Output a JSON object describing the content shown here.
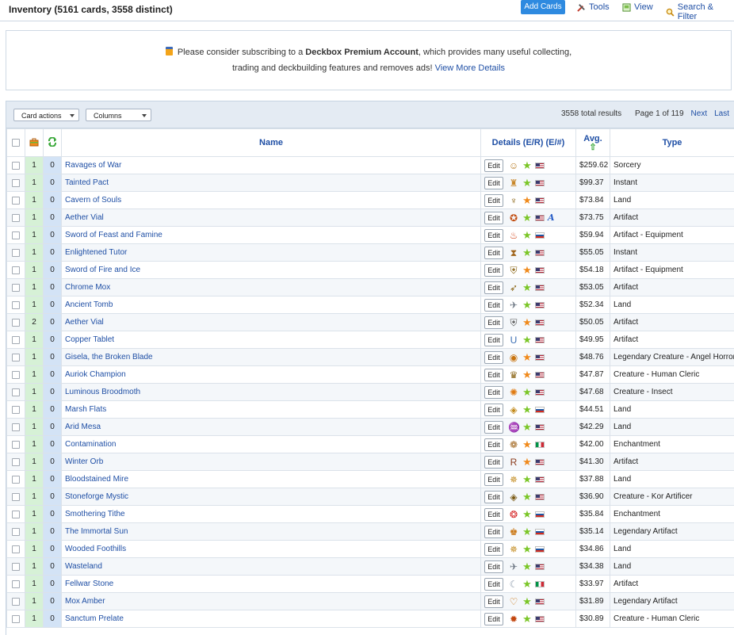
{
  "header": {
    "title": "Inventory (5161 cards, 3558 distinct)",
    "add_cards": "Add Cards",
    "tools": "Tools",
    "view": "View",
    "search_filter": "Search & Filter"
  },
  "promo": {
    "line1_pre": "Please consider subscribing to a ",
    "line1_bold": "Deckbox Premium Account",
    "line1_post": ", which provides many useful collecting,",
    "line2_pre": "trading and deckbuilding features and removes ads! ",
    "line2_link": "View More Details"
  },
  "toolbar": {
    "card_actions": "Card actions",
    "columns": "Columns",
    "results": "3558 total results",
    "page": "Page 1 of 119",
    "next": "Next",
    "last": "Last"
  },
  "columns": {
    "name": "Name",
    "details": "Details (E/R) (E/#)",
    "avg": "Avg.",
    "type": "Type"
  },
  "colors": {
    "link": "#1f4fa5",
    "button": "#2e8ae0",
    "qty_green": "#d6f1d6",
    "qty_blue": "#d3e3f6"
  },
  "rows": [
    {
      "q1": "1",
      "q2": "0",
      "name": "Ravages of War",
      "set": "☺",
      "set_color": "#b7791f",
      "star": "green",
      "flag": "us",
      "alt": "",
      "price": "$259.62",
      "type": "Sorcery"
    },
    {
      "q1": "1",
      "q2": "0",
      "name": "Tainted Pact",
      "set": "♜",
      "set_color": "#c8872a",
      "star": "green",
      "flag": "us",
      "alt": "",
      "price": "$99.37",
      "type": "Instant"
    },
    {
      "q1": "1",
      "q2": "0",
      "name": "Cavern of Souls",
      "set": "♆",
      "set_color": "#8a6414",
      "star": "orange",
      "flag": "us",
      "alt": "",
      "price": "$73.84",
      "type": "Land"
    },
    {
      "q1": "1",
      "q2": "0",
      "name": "Aether Vial",
      "set": "✪",
      "set_color": "#c24e12",
      "star": "green",
      "flag": "us",
      "alt": "A",
      "price": "$73.75",
      "type": "Artifact"
    },
    {
      "q1": "1",
      "q2": "0",
      "name": "Sword of Feast and Famine",
      "set": "♨",
      "set_color": "#d3451b",
      "star": "green",
      "flag": "ru",
      "alt": "",
      "price": "$59.94",
      "type": "Artifact - Equipment"
    },
    {
      "q1": "1",
      "q2": "0",
      "name": "Enlightened Tutor",
      "set": "⧗",
      "set_color": "#a0651c",
      "star": "green",
      "flag": "us",
      "alt": "",
      "price": "$55.05",
      "type": "Instant"
    },
    {
      "q1": "1",
      "q2": "0",
      "name": "Sword of Fire and Ice",
      "set": "⛨",
      "set_color": "#8a6414",
      "star": "orange",
      "flag": "us",
      "alt": "",
      "price": "$54.18",
      "type": "Artifact - Equipment"
    },
    {
      "q1": "1",
      "q2": "0",
      "name": "Chrome Mox",
      "set": "➶",
      "set_color": "#8a6414",
      "star": "green",
      "flag": "us",
      "alt": "",
      "price": "$53.05",
      "type": "Artifact"
    },
    {
      "q1": "1",
      "q2": "0",
      "name": "Ancient Tomb",
      "set": "✈",
      "set_color": "#707a86",
      "star": "green",
      "flag": "us",
      "alt": "",
      "price": "$52.34",
      "type": "Land"
    },
    {
      "q1": "2",
      "q2": "0",
      "name": "Aether Vial",
      "set": "⛨",
      "set_color": "#555555",
      "star": "orange",
      "flag": "us",
      "alt": "",
      "price": "$50.05",
      "type": "Artifact"
    },
    {
      "q1": "1",
      "q2": "0",
      "name": "Copper Tablet",
      "set": "U",
      "set_color": "#3b6fb4",
      "star": "green",
      "flag": "us",
      "alt": "",
      "price": "$49.95",
      "type": "Artifact"
    },
    {
      "q1": "1",
      "q2": "0",
      "name": "Gisela, the Broken Blade",
      "set": "◉",
      "set_color": "#c9740f",
      "star": "orange",
      "flag": "us",
      "alt": "",
      "price": "$48.76",
      "type": "Legendary Creature - Angel Horror"
    },
    {
      "q1": "1",
      "q2": "0",
      "name": "Auriok Champion",
      "set": "♛",
      "set_color": "#8a6414",
      "star": "orange",
      "flag": "us",
      "alt": "",
      "price": "$47.87",
      "type": "Creature - Human Cleric"
    },
    {
      "q1": "1",
      "q2": "0",
      "name": "Luminous Broodmoth",
      "set": "✺",
      "set_color": "#e07a10",
      "star": "green",
      "flag": "us",
      "alt": "",
      "price": "$47.68",
      "type": "Creature - Insect"
    },
    {
      "q1": "1",
      "q2": "0",
      "name": "Marsh Flats",
      "set": "◈",
      "set_color": "#c28a1c",
      "star": "green",
      "flag": "ru",
      "alt": "",
      "price": "$44.51",
      "type": "Land"
    },
    {
      "q1": "1",
      "q2": "0",
      "name": "Arid Mesa",
      "set": "♒",
      "set_color": "#8a6414",
      "star": "green",
      "flag": "us",
      "alt": "",
      "price": "$42.29",
      "type": "Land"
    },
    {
      "q1": "1",
      "q2": "0",
      "name": "Contamination",
      "set": "❁",
      "set_color": "#a0651c",
      "star": "orange",
      "flag": "it",
      "alt": "",
      "price": "$42.00",
      "type": "Enchantment"
    },
    {
      "q1": "1",
      "q2": "0",
      "name": "Winter Orb",
      "set": "R",
      "set_color": "#8a3a1a",
      "star": "orange",
      "flag": "us",
      "alt": "",
      "price": "$41.30",
      "type": "Artifact"
    },
    {
      "q1": "1",
      "q2": "0",
      "name": "Bloodstained Mire",
      "set": "✵",
      "set_color": "#c28a1c",
      "star": "green",
      "flag": "us",
      "alt": "",
      "price": "$37.88",
      "type": "Land"
    },
    {
      "q1": "1",
      "q2": "0",
      "name": "Stoneforge Mystic",
      "set": "◈",
      "set_color": "#7a5a14",
      "star": "green",
      "flag": "us",
      "alt": "",
      "price": "$36.90",
      "type": "Creature - Kor Artificer"
    },
    {
      "q1": "1",
      "q2": "0",
      "name": "Smothering Tithe",
      "set": "❂",
      "set_color": "#d41f1f",
      "star": "green",
      "flag": "ru",
      "alt": "",
      "price": "$35.84",
      "type": "Enchantment"
    },
    {
      "q1": "1",
      "q2": "0",
      "name": "The Immortal Sun",
      "set": "♚",
      "set_color": "#c9740f",
      "star": "green",
      "flag": "ru",
      "alt": "",
      "price": "$35.14",
      "type": "Legendary Artifact"
    },
    {
      "q1": "1",
      "q2": "0",
      "name": "Wooded Foothills",
      "set": "✵",
      "set_color": "#c28a1c",
      "star": "green",
      "flag": "ru",
      "alt": "",
      "price": "$34.86",
      "type": "Land"
    },
    {
      "q1": "1",
      "q2": "0",
      "name": "Wasteland",
      "set": "✈",
      "set_color": "#707a86",
      "star": "green",
      "flag": "us",
      "alt": "",
      "price": "$34.38",
      "type": "Land"
    },
    {
      "q1": "1",
      "q2": "0",
      "name": "Fellwar Stone",
      "set": "☾",
      "set_color": "#8a98aa",
      "star": "green",
      "flag": "it",
      "alt": "",
      "price": "$33.97",
      "type": "Artifact"
    },
    {
      "q1": "1",
      "q2": "0",
      "name": "Mox Amber",
      "set": "♡",
      "set_color": "#c9740f",
      "star": "green",
      "flag": "us",
      "alt": "",
      "price": "$31.89",
      "type": "Legendary Artifact"
    },
    {
      "q1": "1",
      "q2": "0",
      "name": "Sanctum Prelate",
      "set": "✹",
      "set_color": "#c2460f",
      "star": "green",
      "flag": "us",
      "alt": "",
      "price": "$30.89",
      "type": "Creature - Human Cleric"
    }
  ]
}
